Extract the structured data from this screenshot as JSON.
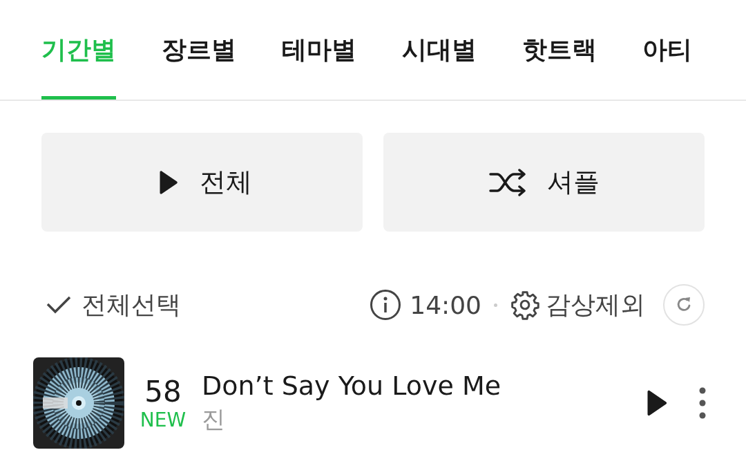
{
  "tabs": [
    {
      "label": "기간별",
      "selected": true
    },
    {
      "label": "장르별",
      "selected": false
    },
    {
      "label": "테마별",
      "selected": false
    },
    {
      "label": "시대별",
      "selected": false
    },
    {
      "label": "핫트랙",
      "selected": false
    },
    {
      "label": "아티",
      "selected": false
    }
  ],
  "actions": [
    {
      "kind": "play",
      "label": "전체"
    },
    {
      "kind": "shuffle",
      "label": "셔플"
    }
  ],
  "toolbar": {
    "select_all": "전체선택",
    "time": "14:00",
    "exclude": "감상제외"
  },
  "tracks": [
    {
      "rank": "58",
      "badge": "NEW",
      "title": "Don’t Say You Love Me",
      "artist": "진"
    }
  ]
}
